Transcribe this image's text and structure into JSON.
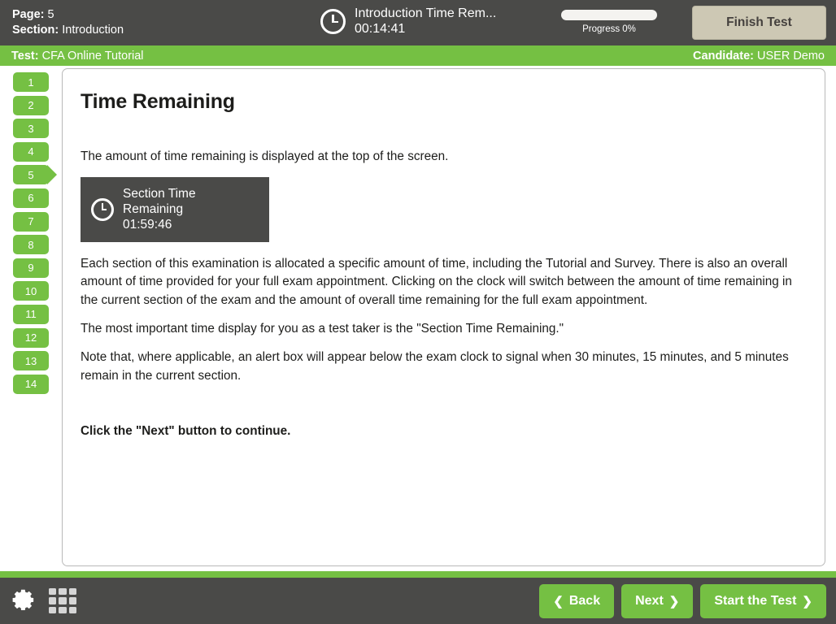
{
  "header": {
    "page_label": "Page:",
    "page_value": "5",
    "section_label": "Section:",
    "section_value": "Introduction",
    "clock_icon": "clock-icon",
    "timer_label": "Introduction Time Rem...",
    "timer_value": "00:14:41",
    "progress_label": "Progress 0%",
    "progress_percent": 0,
    "finish_test_label": "Finish Test"
  },
  "green_bar": {
    "test_label": "Test:",
    "test_value": "CFA Online Tutorial",
    "candidate_label": "Candidate:",
    "candidate_value": "USER Demo"
  },
  "sidebar": {
    "items": [
      {
        "label": "1",
        "current": false
      },
      {
        "label": "2",
        "current": false
      },
      {
        "label": "3",
        "current": false
      },
      {
        "label": "4",
        "current": false
      },
      {
        "label": "5",
        "current": true
      },
      {
        "label": "6",
        "current": false
      },
      {
        "label": "7",
        "current": false
      },
      {
        "label": "8",
        "current": false
      },
      {
        "label": "9",
        "current": false
      },
      {
        "label": "10",
        "current": false
      },
      {
        "label": "11",
        "current": false
      },
      {
        "label": "12",
        "current": false
      },
      {
        "label": "13",
        "current": false
      },
      {
        "label": "14",
        "current": false
      }
    ]
  },
  "content": {
    "title": "Time Remaining",
    "intro": "The amount of time remaining is displayed at the top of the screen.",
    "section_timer": {
      "icon": "clock-icon",
      "label": "Section Time Remaining",
      "value": "01:59:46"
    },
    "paragraph_1": "Each section of this examination is allocated a specific amount of time, including the Tutorial and Survey. There is also an overall amount of time provided for your full exam appointment. Clicking on the clock will switch between the amount of time remaining in the current section of the exam and the amount of overall time remaining for the full exam appointment.",
    "paragraph_2": "The most important time display for you as a test taker is the \"Section Time Remaining.\"",
    "paragraph_3": "Note that, where applicable, an alert box will appear below the exam clock to signal when 30 minutes, 15 minutes, and 5 minutes remain in the current section.",
    "call_to_action": "Click the \"Next\" button to continue."
  },
  "footer": {
    "settings_icon": "gear-icon",
    "grid_icon": "grid-menu-icon",
    "back_label": "Back",
    "back_chevron": "❮",
    "next_label": "Next",
    "next_chevron": "❯",
    "start_label": "Start the Test",
    "start_chevron": "❯"
  },
  "colors": {
    "brand_green": "#75c043",
    "dark_gray": "#4a4a48",
    "finish_beige": "#cdc8b4"
  }
}
